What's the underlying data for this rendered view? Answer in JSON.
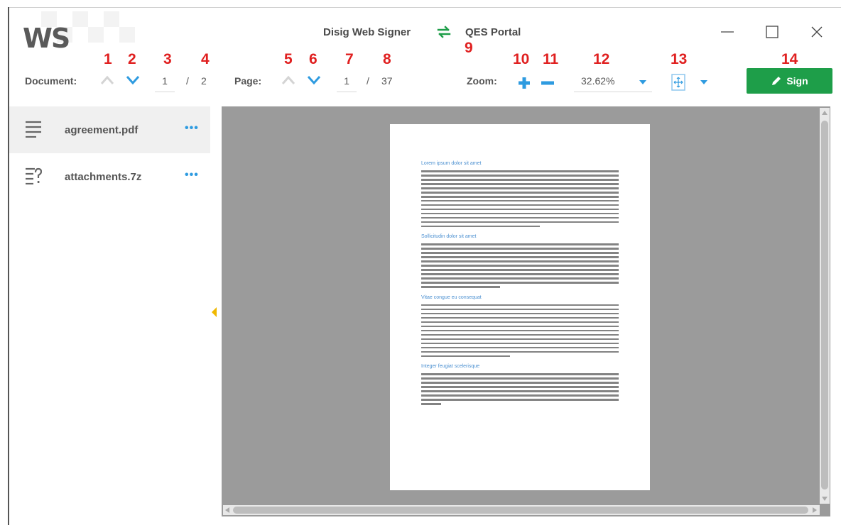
{
  "window": {
    "logo": "WS",
    "app_title": "Disig Web Signer",
    "portal_title": "QES Portal"
  },
  "annotations": [
    "1",
    "2",
    "3",
    "4",
    "5",
    "6",
    "7",
    "8",
    "9",
    "10",
    "11",
    "12",
    "13",
    "14"
  ],
  "toolbar": {
    "document_label": "Document:",
    "document_current": "1",
    "document_separator": "/",
    "document_total": "2",
    "page_label": "Page:",
    "page_current": "1",
    "page_separator": "/",
    "page_total": "37",
    "zoom_label": "Zoom:",
    "zoom_value": "32.62%",
    "sign_label": "Sign"
  },
  "sidebar": {
    "items": [
      {
        "name": "agreement.pdf",
        "icon": "document-lines-icon",
        "active": true
      },
      {
        "name": "attachments.7z",
        "icon": "unknown-document-icon",
        "active": false
      }
    ],
    "more_label": "•••"
  },
  "document_preview": {
    "headings": [
      "Lorem ipsum dolor sit amet",
      "Sollicitudin dolor sit amet",
      "Vitae congue eu consequat",
      "Integer feugiat scelerisque"
    ]
  },
  "colors": {
    "accent": "#2e9be0",
    "sign_button": "#1e9e49",
    "annotation": "#e02020",
    "viewer_bg": "#9b9b9b"
  }
}
